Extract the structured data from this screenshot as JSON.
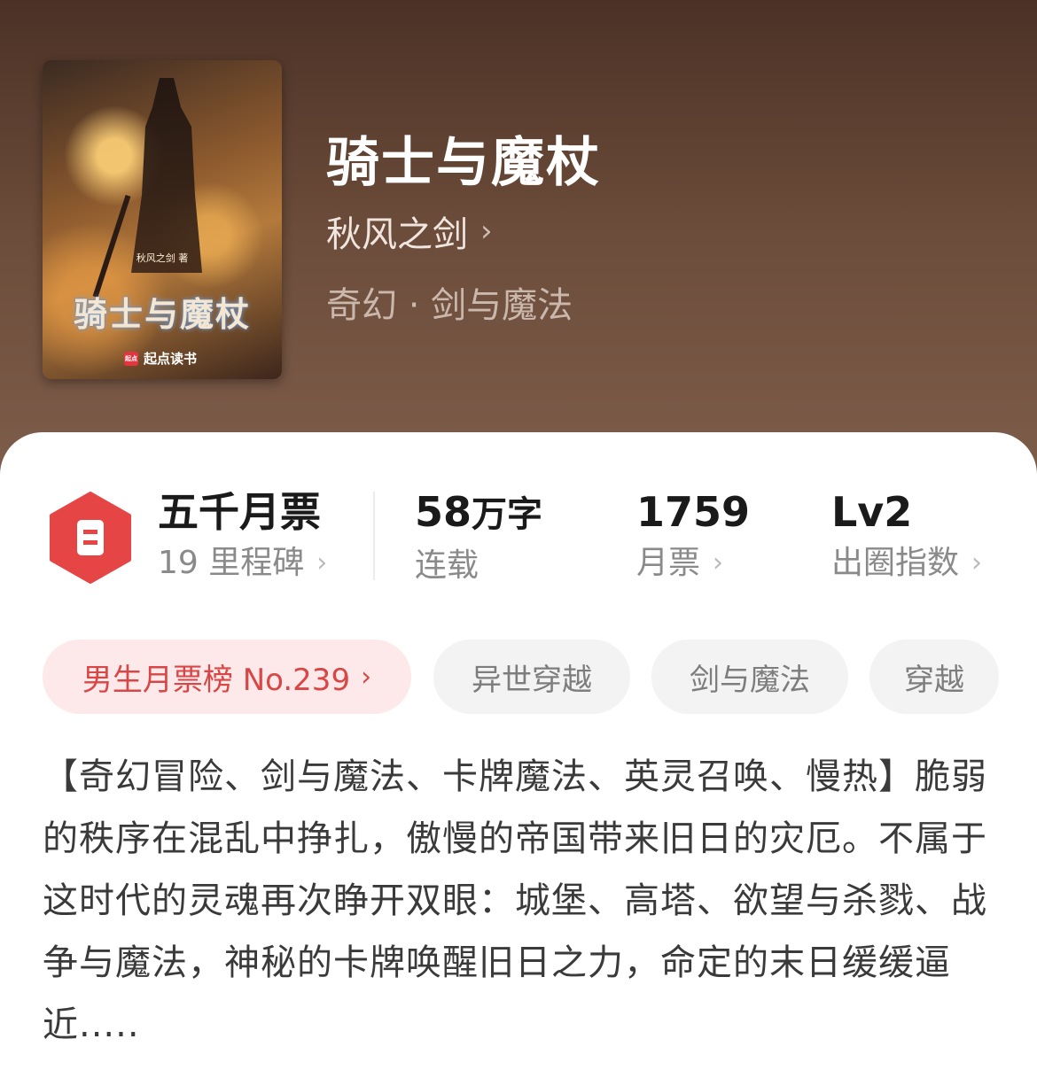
{
  "book": {
    "title": "骑士与魔杖",
    "author": "秋风之剑",
    "genre": "奇幻 · 剑与魔法"
  },
  "cover": {
    "title": "骑士与魔杖",
    "author_line": "秋风之剑 著",
    "brand": "起点读书",
    "brand_logo": "起点"
  },
  "stats": {
    "milestone": {
      "title": "五千月票",
      "sub": "19 里程碑"
    },
    "words": {
      "value": "58",
      "unit": "万字",
      "label": "连载"
    },
    "tickets": {
      "value": "1759",
      "label": "月票"
    },
    "level": {
      "value": "Lv2",
      "label": "出圈指数"
    }
  },
  "tags": {
    "rank": "男生月票榜 No.239",
    "items": [
      "异世穿越",
      "剑与魔法",
      "穿越"
    ]
  },
  "description": "【奇幻冒险、剑与魔法、卡牌魔法、英灵召唤、慢热】脆弱的秩序在混乱中挣扎，傲慢的帝国带来旧日的灾厄。不属于这时代的灵魂再次睁开双眼：城堡、高塔、欲望与杀戮、战争与魔法，神秘的卡牌唤醒旧日之力，命定的末日缓缓逼近.....",
  "colors": {
    "header": "#6b4b39",
    "accent_red": "#e64545",
    "rank_bg": "#fde9e9"
  },
  "icons": {
    "chevron": "chevron-right-icon",
    "badge": "ticket-badge-icon"
  }
}
